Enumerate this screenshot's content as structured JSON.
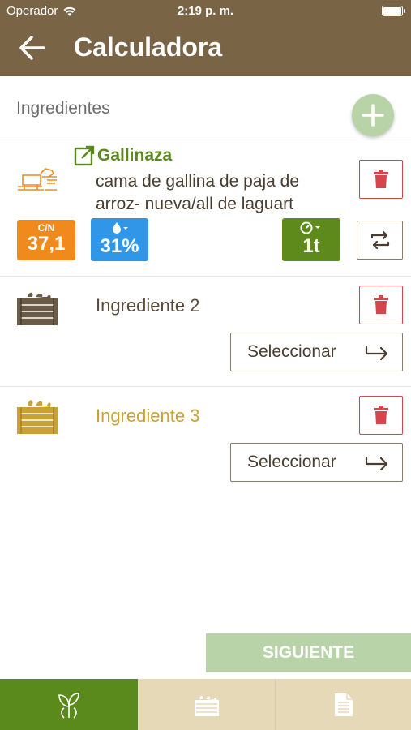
{
  "status_bar": {
    "carrier": "Operador",
    "time": "2:19 p. m."
  },
  "header": {
    "title": "Calculadora",
    "back_icon": "arrow-left-icon"
  },
  "section": {
    "title": "Ingredientes",
    "add_icon": "plus-icon"
  },
  "ingredients": [
    {
      "name": "Gallinaza",
      "description": "cama de gallina de paja de arroz- nueva/all de laguart",
      "cn_label": "C/N",
      "cn_value": "37,1",
      "humidity_value": "31%",
      "weight_value": "1t",
      "icon": "chicken-manure-icon"
    },
    {
      "name": "Ingrediente 2",
      "select_label": "Seleccionar",
      "icon": "crate-icon",
      "color": "#6b5a45"
    },
    {
      "name": "Ingrediente 3",
      "select_label": "Seleccionar",
      "icon": "crate-icon",
      "color": "#c9a232"
    }
  ],
  "next_button": {
    "label": "SIGUIENTE"
  },
  "tabs": [
    {
      "icon": "plant-leaves-icon",
      "active": true
    },
    {
      "icon": "compost-crate-icon",
      "active": false
    },
    {
      "icon": "document-icon",
      "active": false
    }
  ],
  "colors": {
    "header": "#7a6446",
    "accent_green": "#5b8a1c",
    "delete_red": "#d4464b",
    "cn_orange": "#f08a1d",
    "humidity_blue": "#2f96e8"
  }
}
